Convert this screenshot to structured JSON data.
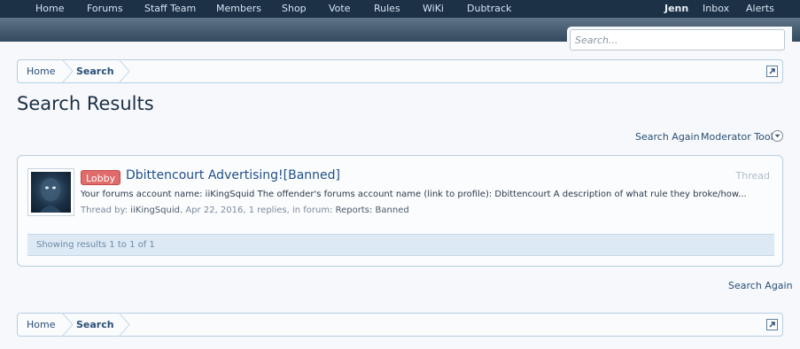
{
  "nav": {
    "items": [
      "Home",
      "Forums",
      "Staff Team",
      "Members",
      "Shop",
      "Vote",
      "Rules",
      "WiKi",
      "Dubtrack"
    ],
    "user": "Jenn",
    "inbox": "Inbox",
    "alerts": "Alerts"
  },
  "search": {
    "placeholder": "Search..."
  },
  "breadcrumb": {
    "home": "Home",
    "current": "Search"
  },
  "page": {
    "title": "Search Results"
  },
  "tools": {
    "search_again": "Search Again",
    "moderator_tools": "Moderator Tools"
  },
  "result": {
    "prefix": "Lobby",
    "title": "Dbittencourt Advertising![Banned]",
    "content_type": "Thread",
    "snippet": "Your forums account name: iiKingSquid The offender's forums account name (link to profile): Dbittencourt A description of what rule they broke/how...",
    "meta_prefix": "Thread by:",
    "author": "iiKingSquid",
    "date": "Apr 22, 2016",
    "replies": "1 replies, in forum:",
    "forum": "Reports: Banned"
  },
  "pager": {
    "text": "Showing results 1 to 1 of 1"
  },
  "bottom": {
    "search_again": "Search Again"
  },
  "colors": {
    "navbar": "#1d3146",
    "prefix_badge": "#e06b6b",
    "link": "#2a4f76"
  },
  "icons": {
    "jump": "external-jump-icon",
    "mod_tools_toggle": "chevron-down-icon"
  }
}
